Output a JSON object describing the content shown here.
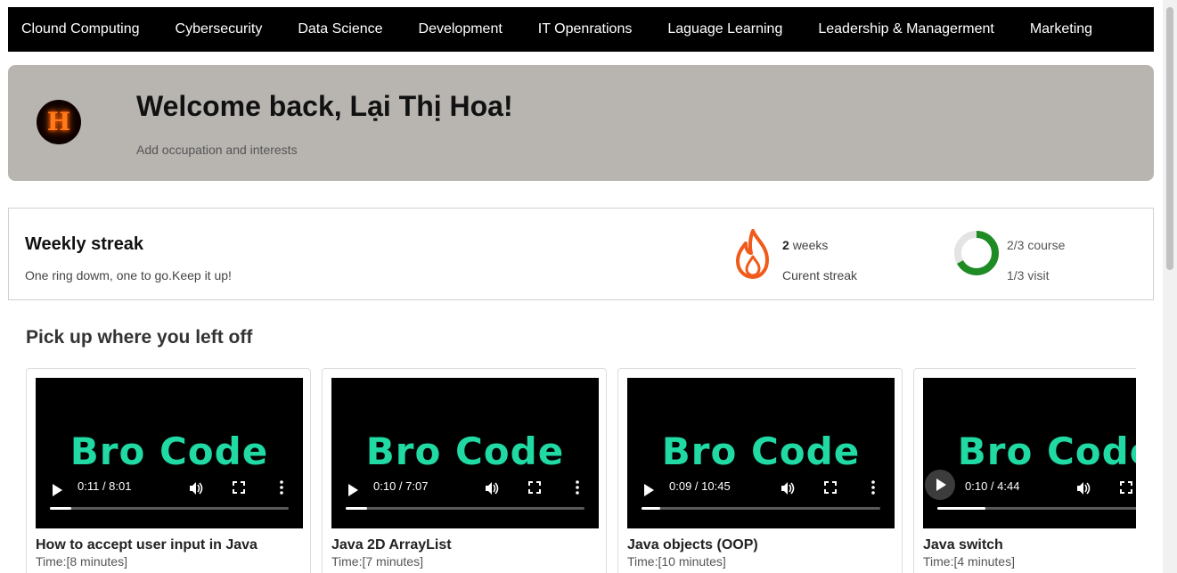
{
  "nav": {
    "items": [
      "Clound Computing",
      "Cybersecurity",
      "Data Science",
      "Development",
      "IT Openrations",
      "Laguage Learning",
      "Leadership & Managerment",
      "Marketing"
    ]
  },
  "hero": {
    "avatar_letter": "H",
    "title": "Welcome back, Lại Thị Hoa!",
    "subtitle": "Add occupation and interests"
  },
  "streak": {
    "title": "Weekly streak",
    "message": "One ring dowm, one to go.Keep it up!",
    "weeks_count": "2",
    "weeks_label": "weeks",
    "current_label": "Curent streak",
    "course_progress": "2/3 course",
    "visit_progress": "1/3 visit",
    "course_ring_fraction": 0.67,
    "icons": {
      "flame": "flame-icon",
      "ring": "progress-ring-icon"
    },
    "colors": {
      "flame": "#f05a1a",
      "ring": "#1f8b24"
    }
  },
  "section": {
    "title": "Pick up where you left off"
  },
  "cards": [
    {
      "title": "How to accept user input in Java",
      "duration": "Time:[8 minutes]",
      "video_logo": "Bro Code",
      "time_display": "0:11 / 8:01",
      "progress": 0.09
    },
    {
      "title": "Java 2D ArrayList",
      "duration": "Time:[7 minutes]",
      "video_logo": "Bro Code",
      "time_display": "0:10 / 7:07",
      "progress": 0.09
    },
    {
      "title": "Java objects (OOP)",
      "duration": "Time:[10 minutes]",
      "video_logo": "Bro Code",
      "time_display": "0:09 / 10:45",
      "progress": 0.08
    },
    {
      "title": "Java switch",
      "duration": "Time:[4 minutes]",
      "video_logo": "Bro Code",
      "time_display": "0:10 / 4:44",
      "progress": 0.2
    }
  ],
  "colors": {
    "nav_bg": "#000000",
    "hero_bg": "#b8b5b1",
    "logo_teal": "#20d9a3"
  }
}
